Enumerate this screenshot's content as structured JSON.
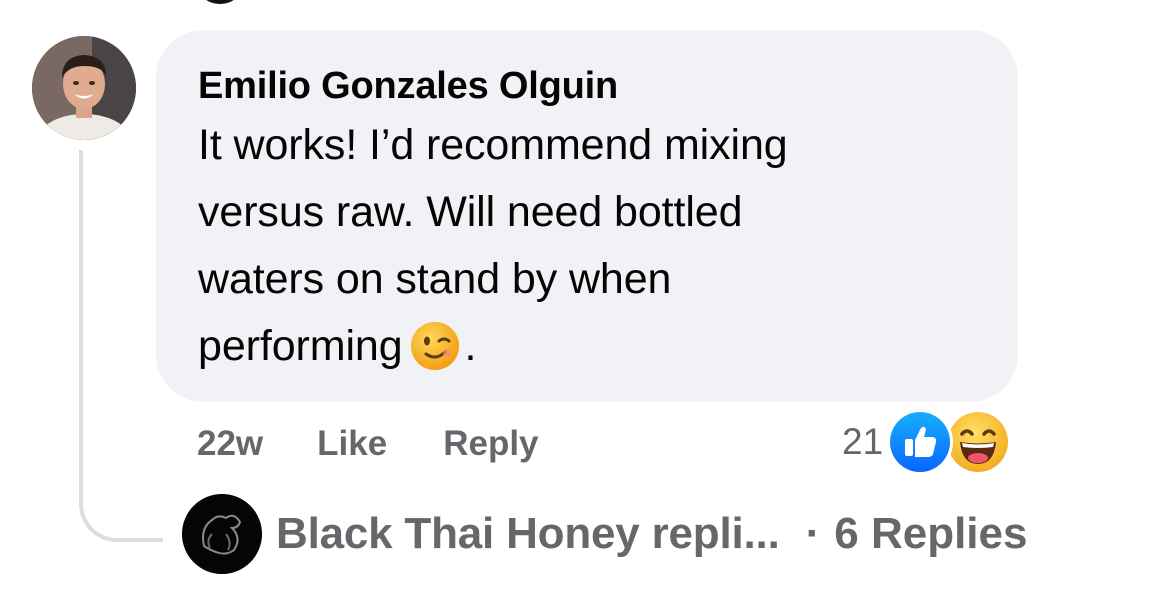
{
  "comment": {
    "author": "Emilio Gonzales Olguin",
    "text_lines": [
      "It works! I’d recommend mixing",
      "versus raw. Will need bottled",
      "waters on stand by when",
      "performing"
    ],
    "text_end_emoji": "winking-face",
    "text_trailing": ".",
    "time": "22w",
    "like_label": "Like",
    "reply_label": "Reply",
    "reaction_count": "21",
    "reaction_icons": [
      "like-reaction-icon",
      "haha-reaction-icon"
    ]
  },
  "replies": {
    "summary_text": "Black Thai Honey repli...",
    "separator": "·",
    "count_label": "6 Replies"
  },
  "colors": {
    "bubble_bg": "#f0f2f5",
    "meta_text": "#65676b",
    "like_blue": "#1877f2",
    "thread_line": "#dadde1"
  }
}
